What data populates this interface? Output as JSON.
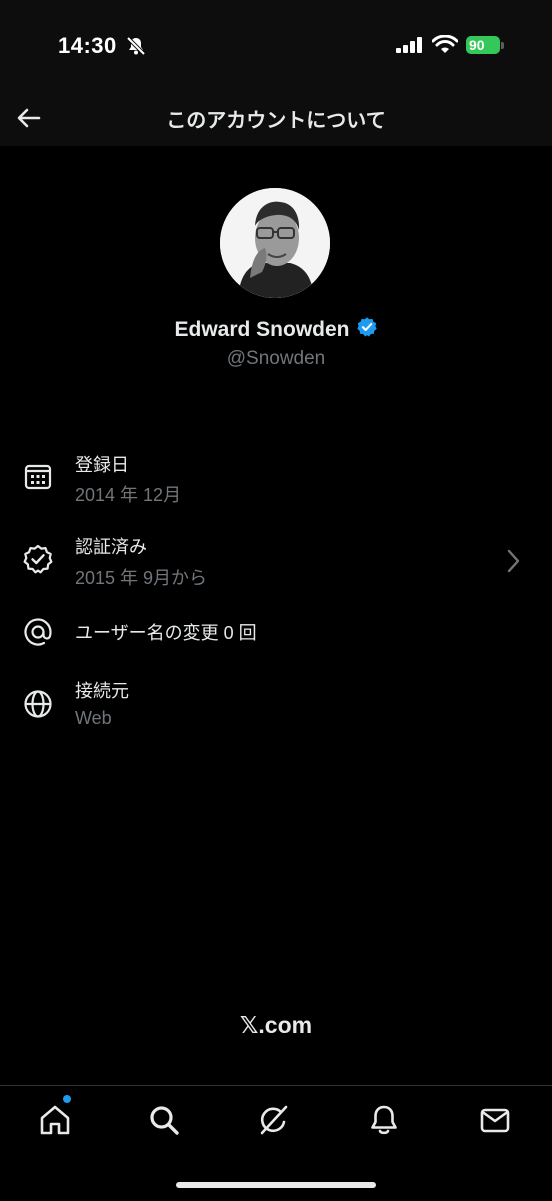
{
  "status_bar": {
    "time": "14:30",
    "battery": "90",
    "icons": [
      "bell-slash-icon",
      "signal-icon",
      "wifi-icon",
      "battery-charging-icon"
    ]
  },
  "header": {
    "title": "このアカウントについて",
    "back_icon": "arrow-left-icon"
  },
  "profile": {
    "name": "Edward Snowden",
    "handle": "@Snowden",
    "verified_color": "#1d9bf0"
  },
  "info_rows": [
    {
      "icon": "calendar-icon",
      "title": "登録日",
      "subtitle": "2014 年 12月"
    },
    {
      "icon": "verified-badge-icon",
      "title": "認証済み",
      "subtitle": "2015 年 9月から",
      "chevron": true
    },
    {
      "icon": "at-icon",
      "title": "ユーザー名の変更 0 回"
    },
    {
      "icon": "globe-icon",
      "title": "接続元",
      "subtitle": "Web"
    }
  ],
  "footer": {
    "text": "𝕏.com"
  },
  "tab_bar": {
    "tabs": [
      "home-icon",
      "search-icon",
      "grok-icon",
      "notifications-icon",
      "messages-icon"
    ],
    "accent": "#1d9bf0"
  }
}
